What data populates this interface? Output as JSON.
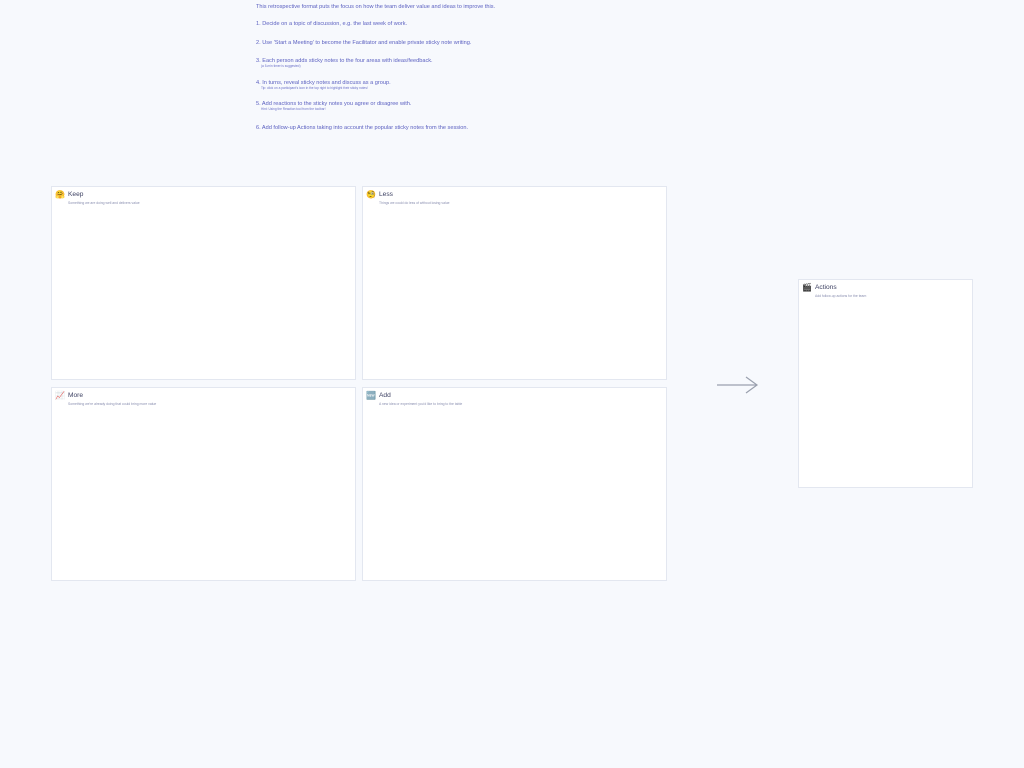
{
  "instructions": {
    "intro": "This retrospective format puts the focus on how the team deliver value and ideas to improve this.",
    "steps": [
      {
        "text": "1. Decide on a topic of discussion, e.g. the last week of work.",
        "hint": ""
      },
      {
        "text": "2. Use 'Start a Meeting' to become the Facilitator and enable private sticky note writing.",
        "hint": ""
      },
      {
        "text": "3. Each person adds sticky notes to the four areas with ideas/feedback.",
        "hint": "(a 5-min timer is suggested)"
      },
      {
        "text": "4. In turns, reveal sticky notes and discuss as a group.",
        "hint": "Tip: click on a participant's icon in the top right to highlight their sticky notes!"
      },
      {
        "text": "5. Add reactions to the sticky notes you agree or disagree with.",
        "hint": "Hint: Using the Reaction tool from the toolbar!"
      },
      {
        "text": "6. Add follow-up Actions taking into account the popular sticky notes from the session.",
        "hint": ""
      }
    ]
  },
  "cards": {
    "keep": {
      "icon": "hugging-face-icon",
      "glyph": "🤗",
      "title": "Keep",
      "description": "Something we are doing well and delivers value"
    },
    "less": {
      "icon": "thinking-face-icon",
      "glyph": "🧐",
      "title": "Less",
      "description": "Things we could do less of without losing value"
    },
    "more": {
      "icon": "chart-increasing-icon",
      "glyph": "📈",
      "title": "More",
      "description": "Something we're already doing that could bring more value"
    },
    "add": {
      "icon": "new-button-icon",
      "glyph": "🆕",
      "title": "Add",
      "description": "A new idea or experiment you'd like to bring to the table"
    },
    "actions": {
      "icon": "clapper-board-icon",
      "glyph": "🎬",
      "title": "Actions",
      "description": "Add follow-up actions for the team"
    }
  },
  "colors": {
    "instruction_text": "#5a5fc0",
    "card_border": "#e3e7f0",
    "arrow": "#9aa0ae"
  }
}
